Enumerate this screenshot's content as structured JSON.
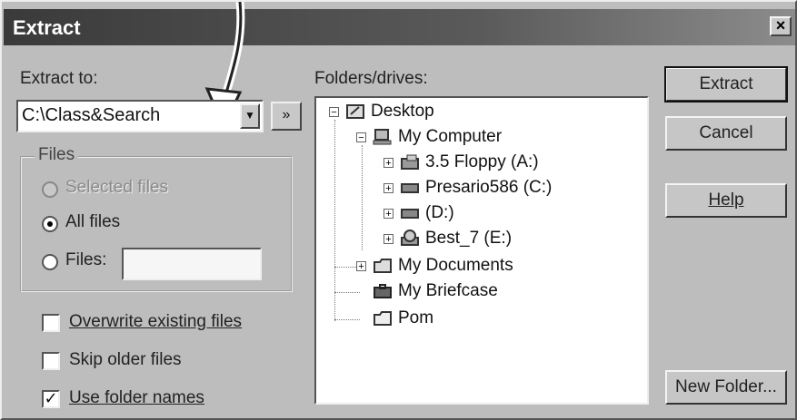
{
  "window": {
    "title": "Extract",
    "close_glyph": "×"
  },
  "left": {
    "extract_to_label": "Extract to:",
    "extract_to_value": "C:\\Class&Search",
    "dropdown_glyph": "▼",
    "more_glyph": "»",
    "files_group": {
      "legend": "Files",
      "selected_files": "Selected files",
      "all_files": "All files",
      "files": "Files:",
      "files_value": ""
    },
    "overwrite": "Overwrite existing files",
    "skip_older": "Skip older files",
    "use_folder_names": "Use folder names",
    "check_glyph": "✓"
  },
  "tree": {
    "label": "Folders/drives:",
    "items": [
      {
        "label": "Desktop",
        "icon": "desktop-icon"
      },
      {
        "label": "My Computer",
        "icon": "computer-icon"
      },
      {
        "label": "3.5 Floppy (A:)",
        "icon": "floppy-icon"
      },
      {
        "label": "Presario586 (C:)",
        "icon": "harddrive-icon"
      },
      {
        "label": "(D:)",
        "icon": "harddrive-icon"
      },
      {
        "label": "Best_7 (E:)",
        "icon": "cdrom-icon"
      },
      {
        "label": "My Documents",
        "icon": "folder-icon"
      },
      {
        "label": "My Briefcase",
        "icon": "briefcase-icon"
      },
      {
        "label": "Pom",
        "icon": "folder-icon"
      }
    ]
  },
  "buttons": {
    "extract": "Extract",
    "cancel": "Cancel",
    "help": "Help",
    "new_folder": "New Folder..."
  }
}
